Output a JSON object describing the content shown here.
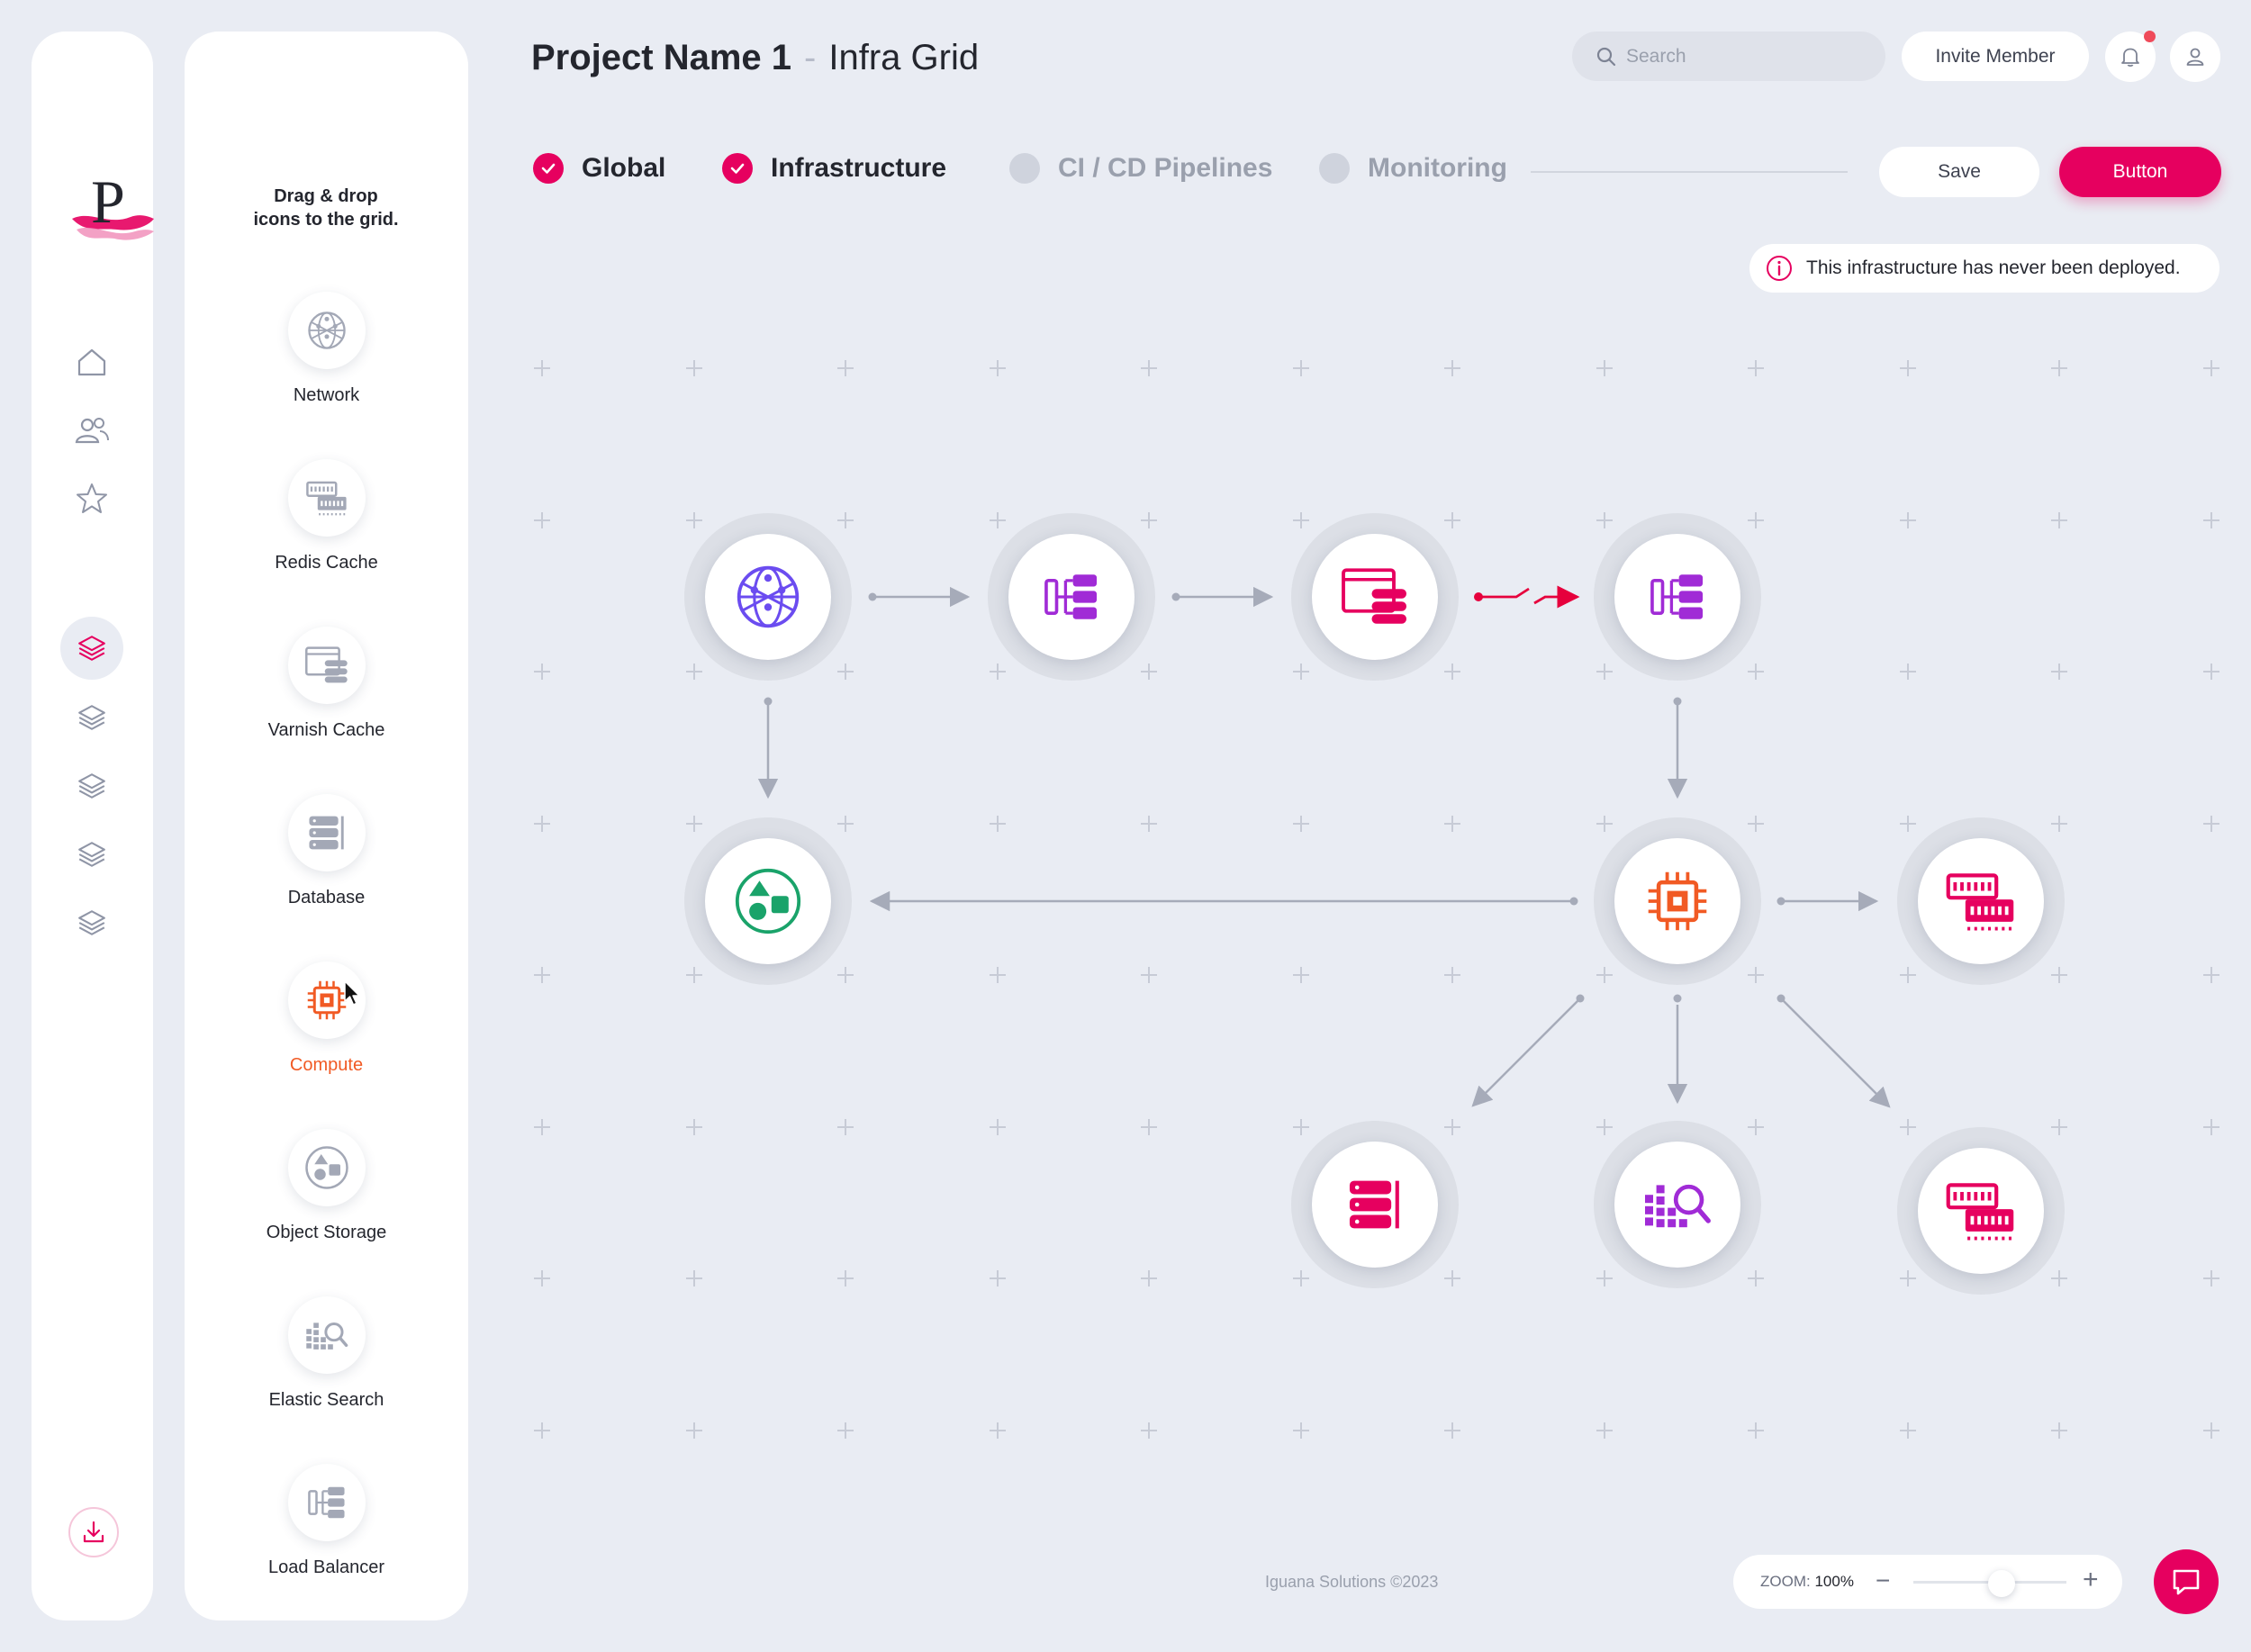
{
  "header": {
    "project_name": "Project Name 1",
    "separator": "-",
    "page_title": "Infra Grid",
    "search_placeholder": "Search",
    "invite_label": "Invite Member",
    "has_notification": true
  },
  "sidebar": {
    "logo_letter": "P",
    "items": [
      {
        "name": "home-icon",
        "active": false
      },
      {
        "name": "team-icon",
        "active": false
      },
      {
        "name": "star-icon",
        "active": false
      },
      {
        "name": "layers-icon",
        "active": true
      },
      {
        "name": "layers-icon",
        "active": false
      },
      {
        "name": "layers-icon",
        "active": false
      },
      {
        "name": "layers-icon",
        "active": false
      },
      {
        "name": "layers-icon",
        "active": false
      }
    ],
    "bottom_icon": "download-icon"
  },
  "palette": {
    "hint": "Drag & drop icons to the grid.",
    "items": [
      {
        "label": "Network",
        "icon": "network-icon"
      },
      {
        "label": "Redis Cache",
        "icon": "memory-icon"
      },
      {
        "label": "Varnish Cache",
        "icon": "cache-icon"
      },
      {
        "label": "Database",
        "icon": "database-icon"
      },
      {
        "label": "Compute",
        "icon": "cpu-icon",
        "hovered": true
      },
      {
        "label": "Object Storage",
        "icon": "object-storage-icon"
      },
      {
        "label": "Elastic Search",
        "icon": "search-analytics-icon"
      },
      {
        "label": "Load Balancer",
        "icon": "load-balancer-icon"
      }
    ]
  },
  "steps": [
    {
      "label": "Global",
      "done": true
    },
    {
      "label": "Infrastructure",
      "done": true
    },
    {
      "label": "CI / CD Pipelines",
      "done": false
    },
    {
      "label": "Monitoring",
      "done": false
    }
  ],
  "actions": {
    "save_label": "Save",
    "primary_label": "Button"
  },
  "alert": {
    "text": "This infrastructure has never been deployed.",
    "icon": "info-icon"
  },
  "canvas": {
    "nodes": [
      {
        "type": "network",
        "icon": "network-icon"
      },
      {
        "type": "load-balancer",
        "icon": "load-balancer-icon"
      },
      {
        "type": "varnish-cache",
        "icon": "cache-icon"
      },
      {
        "type": "load-balancer",
        "icon": "load-balancer-icon"
      },
      {
        "type": "object-storage",
        "icon": "object-storage-icon"
      },
      {
        "type": "compute",
        "icon": "cpu-icon"
      },
      {
        "type": "redis-cache",
        "icon": "memory-icon"
      },
      {
        "type": "database",
        "icon": "database-icon"
      },
      {
        "type": "elastic-search",
        "icon": "search-analytics-icon"
      },
      {
        "type": "redis-cache",
        "icon": "memory-icon"
      }
    ],
    "broken_link_color": "#e6003c"
  },
  "footer": {
    "copyright": "Iguana Solutions ©2023"
  },
  "zoom": {
    "label": "ZOOM:",
    "value": "100%",
    "level": 1.0
  },
  "colors": {
    "accent": "#e6005f",
    "compute": "#f15a24",
    "storage": "#1aa36a",
    "network": "#6b4cf0",
    "lb": "#a02bd6"
  }
}
